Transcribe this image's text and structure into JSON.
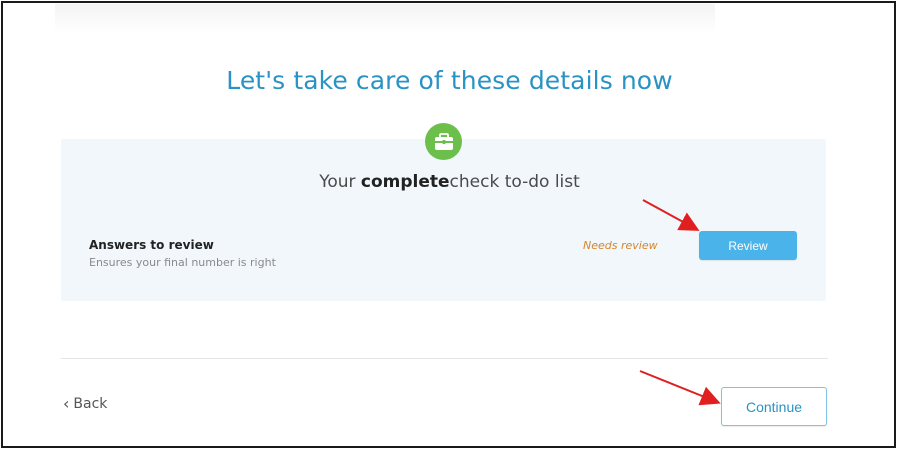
{
  "header": {
    "title": "Let's take care of these details now"
  },
  "checklist": {
    "icon": "briefcase-icon",
    "subtitle_prefix": "Your ",
    "subtitle_bold": "complete",
    "subtitle_suffix": "check to-do list",
    "items": [
      {
        "title": "Answers to review",
        "description": "Ensures your final number is right",
        "status": "Needs review",
        "action_label": "Review"
      }
    ]
  },
  "footer": {
    "back_label": "Back",
    "continue_label": "Continue"
  },
  "colors": {
    "accent": "#2a93c4",
    "icon_green": "#6cbf4b",
    "status_orange": "#d5862a",
    "button_blue": "#4ab4ea",
    "annotation_red": "#e02020"
  }
}
